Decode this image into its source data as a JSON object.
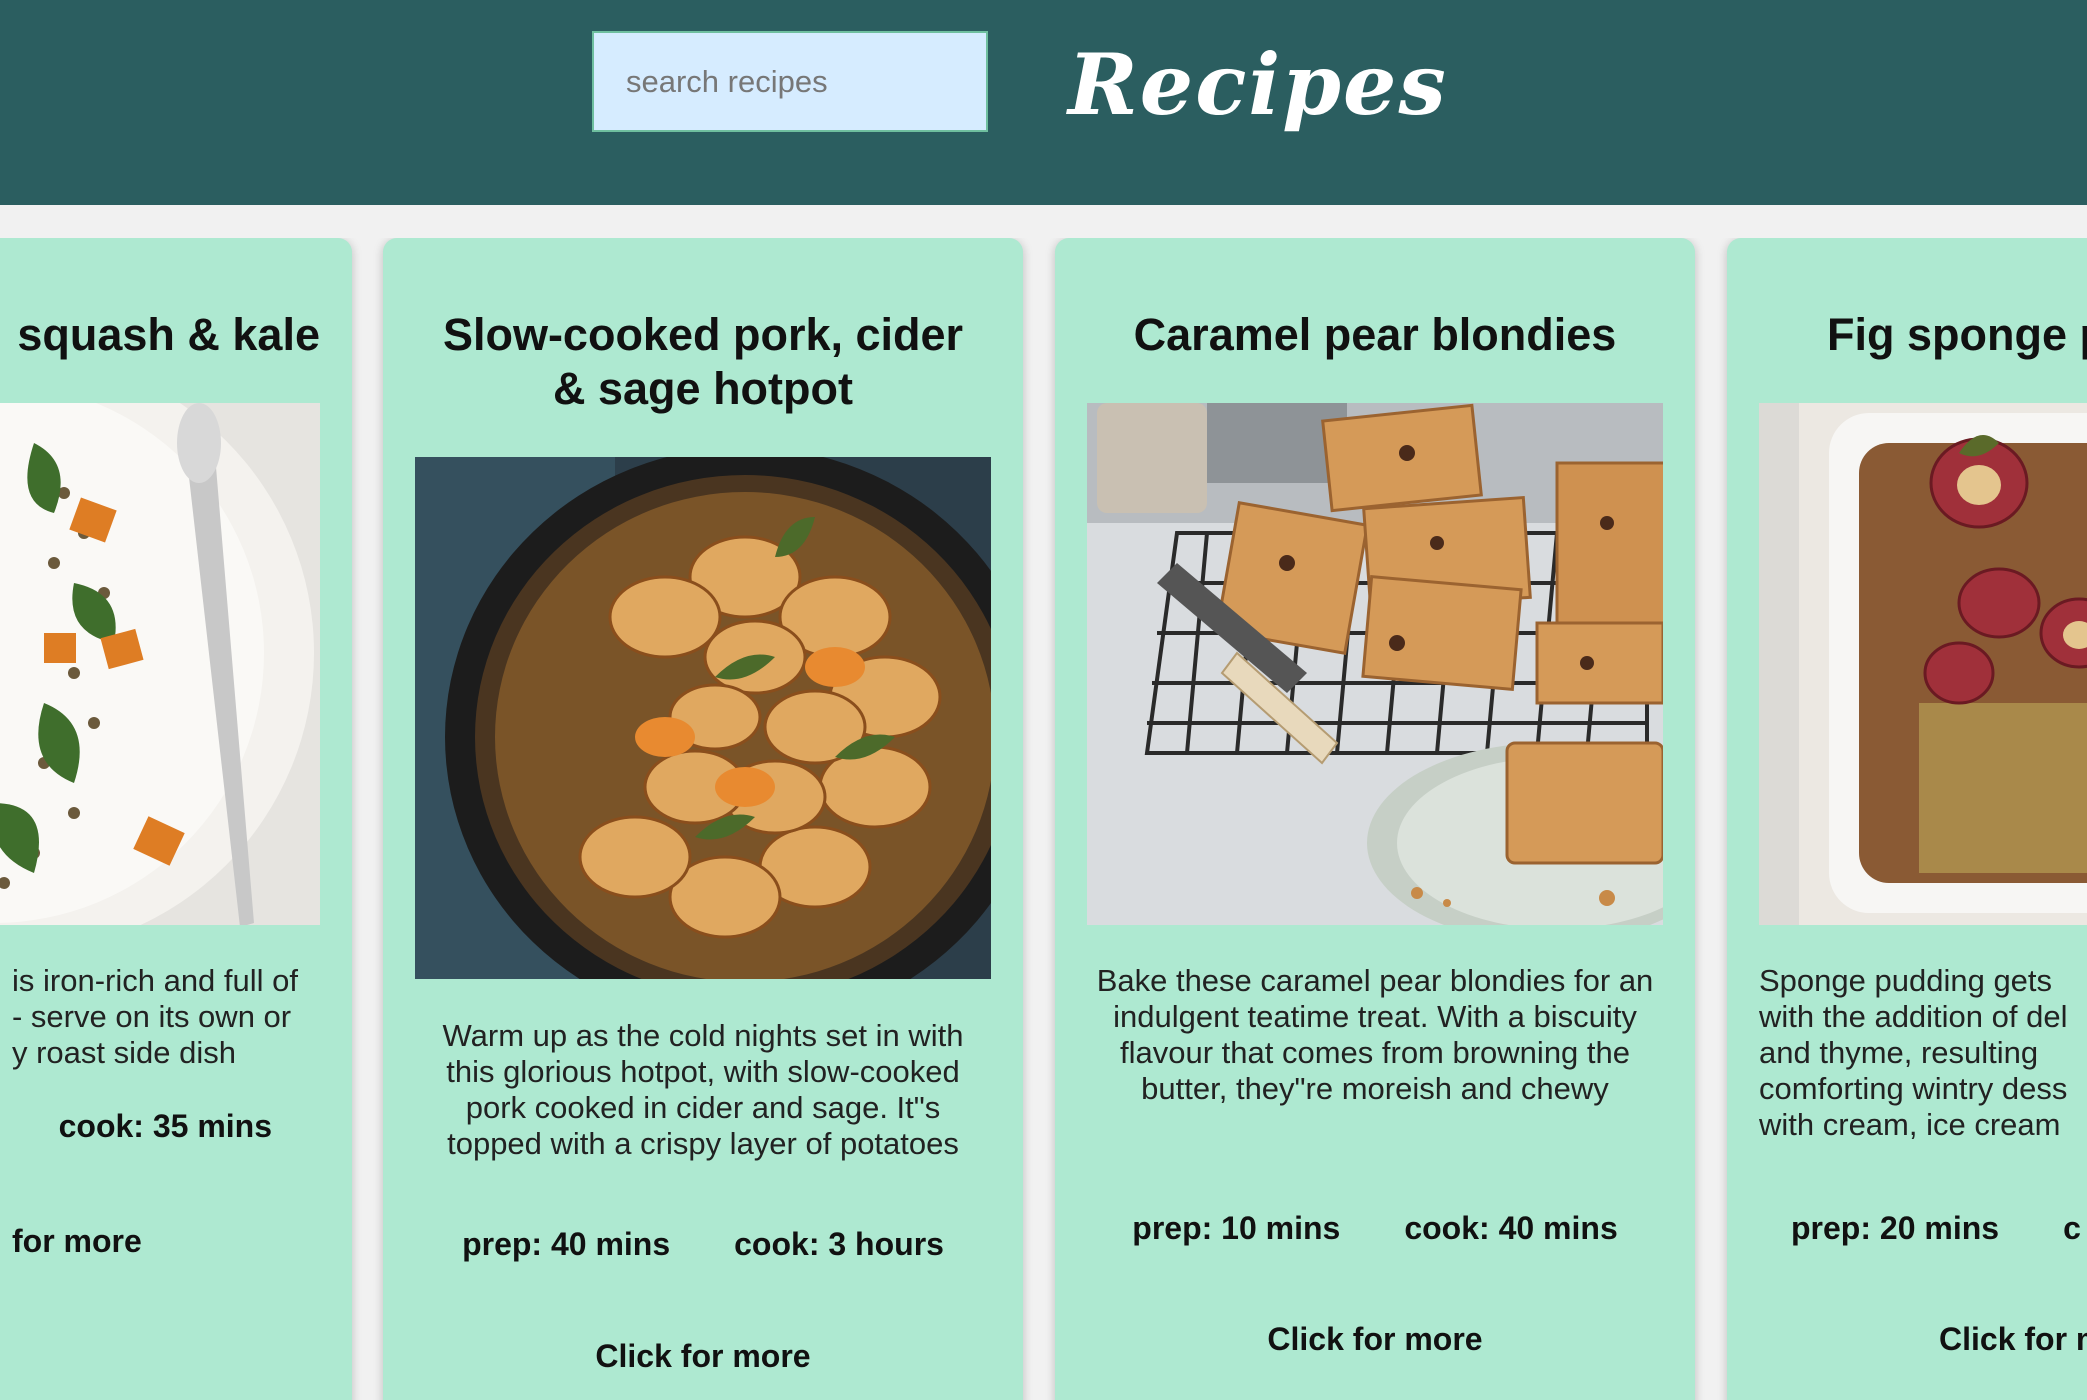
{
  "header": {
    "search_placeholder": "search recipes",
    "title": "Recipes",
    "background_color": "#2b5e60"
  },
  "cards": [
    {
      "title": "squash & kale",
      "description": " is iron-rich and full of\n- serve on its own or\ny roast side dish",
      "prep": "",
      "cook": "cook: 35 mins",
      "more": " for more"
    },
    {
      "title": "Slow-cooked pork, cider & sage hotpot",
      "description": "Warm up as the cold nights set in with this glorious hotpot, with slow-cooked pork cooked in cider and sage. It\"s topped with a crispy layer of potatoes",
      "prep": "prep: 40 mins",
      "cook": "cook: 3 hours",
      "more": "Click for more"
    },
    {
      "title": "Caramel pear blondies",
      "description": "Bake these caramel pear blondies for an indulgent teatime treat. With a biscuity flavour that comes from browning the butter, they\"re moreish and chewy",
      "prep": "prep: 10 mins",
      "cook": "cook: 40 mins",
      "more": "Click for more"
    },
    {
      "title": "Fig sponge p",
      "description": "Sponge pudding gets\nwith the addition of del\nand thyme, resulting\ncomforting wintry dess\nwith cream, ice cream",
      "prep": "prep: 20 mins",
      "cook": "c",
      "more": "Click for m"
    }
  ],
  "colors": {
    "card_background": "#aee9d1",
    "page_background": "#f1f1f1",
    "search_background": "#d6ecff"
  }
}
